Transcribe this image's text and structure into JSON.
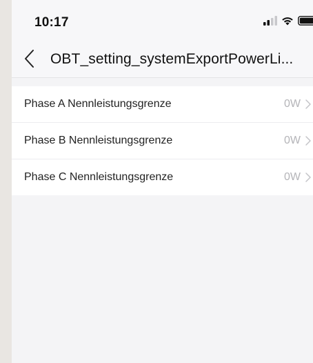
{
  "status_bar": {
    "time": "10:17",
    "icons": [
      "signal-icon",
      "wifi-icon",
      "battery-icon"
    ]
  },
  "nav": {
    "back_icon": "chevron-left-icon",
    "title": "OBT_setting_systemExportPowerLi..."
  },
  "settings": {
    "rows": [
      {
        "label": "Phase A Nennleistungsgrenze",
        "value": "0W"
      },
      {
        "label": "Phase B Nennleistungsgrenze",
        "value": "0W"
      },
      {
        "label": "Phase C Nennleistungsgrenze",
        "value": "0W"
      }
    ]
  },
  "colors": {
    "page_background": "#f4f4f6",
    "list_background": "#ffffff",
    "value_text": "#b4b4b8",
    "label_text": "#222222"
  }
}
